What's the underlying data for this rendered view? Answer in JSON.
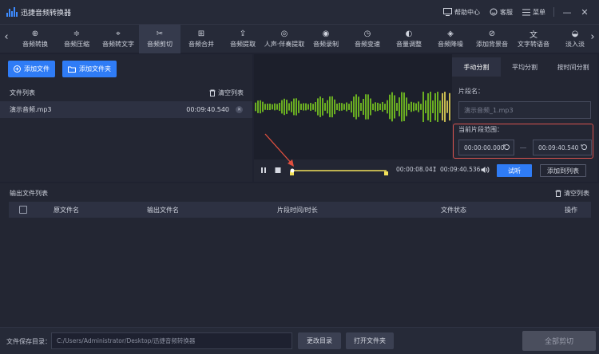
{
  "titlebar": {
    "app_title": "迅捷音频转换器",
    "help_label": "帮助中心",
    "service_label": "客服",
    "menu_label": "菜单",
    "minimize_glyph": "—",
    "close_glyph": "✕"
  },
  "toolbar": {
    "tools": [
      {
        "label": "音频转换",
        "icon": "convert-icon"
      },
      {
        "label": "音频压缩",
        "icon": "compress-icon"
      },
      {
        "label": "音频转文字",
        "icon": "audio-to-text-icon"
      },
      {
        "label": "音频剪切",
        "icon": "scissors-icon"
      },
      {
        "label": "音频合并",
        "icon": "merge-icon"
      },
      {
        "label": "音频提取",
        "icon": "extract-icon"
      },
      {
        "label": "人声·伴奏提取",
        "icon": "vocal-extract-icon"
      },
      {
        "label": "音频录制",
        "icon": "microphone-icon"
      },
      {
        "label": "音频变速",
        "icon": "speed-icon"
      },
      {
        "label": "音量调整",
        "icon": "volume-icon"
      },
      {
        "label": "音频降噪",
        "icon": "denoise-icon"
      },
      {
        "label": "添加背景音",
        "icon": "background-music-icon"
      },
      {
        "label": "文字转语音",
        "icon": "text-to-speech-icon"
      },
      {
        "label": "淡入淡",
        "icon": "fade-icon"
      }
    ],
    "active_index": 3,
    "prev_glyph": "‹",
    "next_glyph": "›"
  },
  "files": {
    "add_file_label": "添加文件",
    "add_folder_label": "添加文件夹",
    "list_title": "文件列表",
    "clear_label": "清空列表",
    "items": [
      {
        "name": "演示音频.mp3",
        "duration": "00:09:40.540"
      }
    ]
  },
  "editor": {
    "tabs": [
      "手动分割",
      "平均分割",
      "按时间分割"
    ],
    "active_tab": 0,
    "segment_name_label": "片段名：",
    "segment_name_placeholder": "演示音频_1.mp3",
    "range_label": "当前片段范围：",
    "range_start": "00:00:00.000",
    "range_end": "00:09:40.540",
    "current_time": "00:00:08.041",
    "separator": "/",
    "total_time": "00:09:40.536",
    "preview_label": "试听",
    "add_to_list_label": "添加到列表"
  },
  "output": {
    "title": "输出文件列表",
    "clear_label": "清空列表",
    "columns": [
      "原文件名",
      "输出文件名",
      "片段时间/时长",
      "文件状态",
      "操作"
    ]
  },
  "bottom": {
    "save_dir_label": "文件保存目录：",
    "save_path": "C:/Users/Administrator/Desktop/迅捷音频转换器",
    "change_dir_label": "更改目录",
    "open_folder_label": "打开文件夹",
    "cut_all_label": "全部剪切"
  },
  "colors": {
    "accent": "#2f7cf6",
    "highlight_border": "#d9534f",
    "wave_played": "#f2e15a",
    "wave_unplayed": "#7ed321",
    "annotation_arrow": "#e2503f"
  }
}
